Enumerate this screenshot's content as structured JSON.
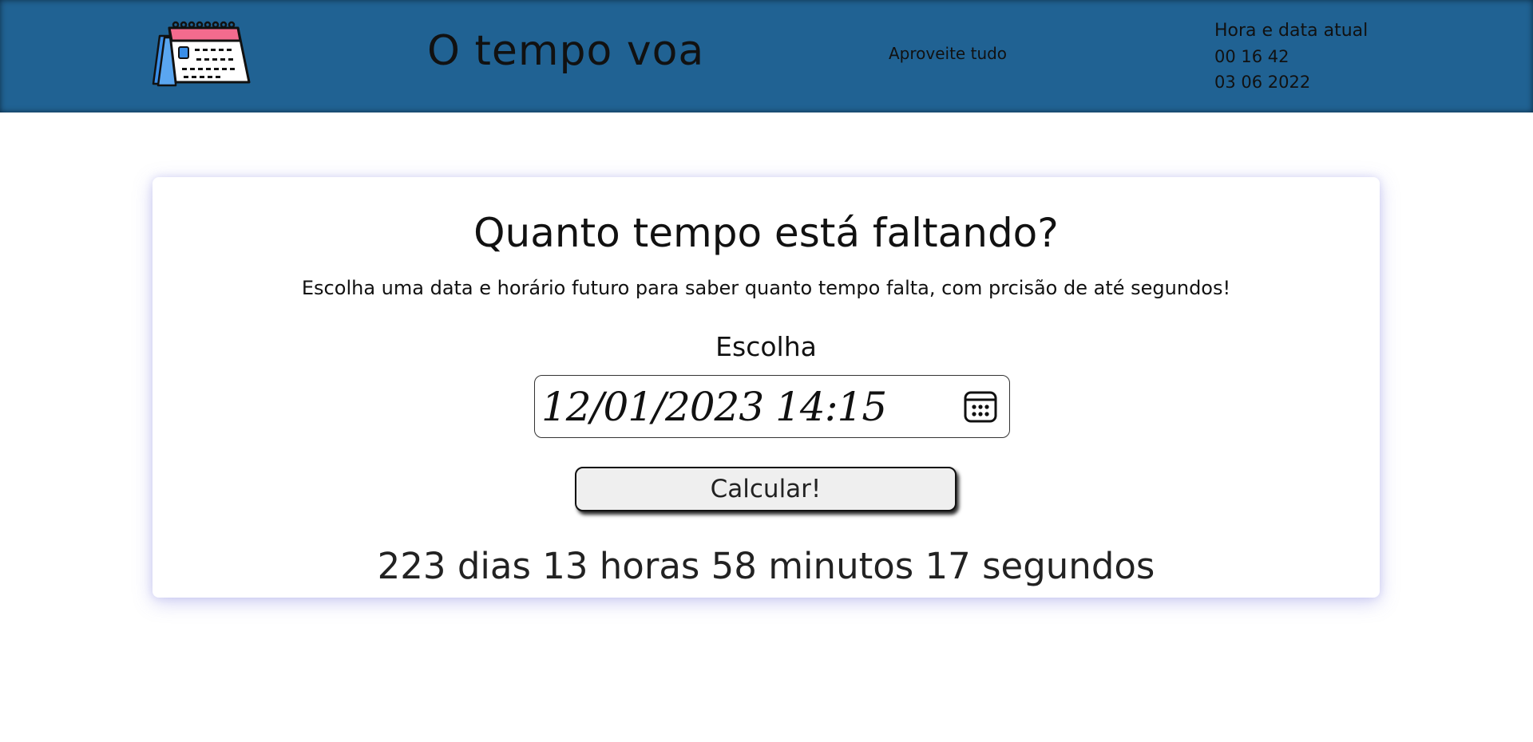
{
  "header": {
    "title": "O tempo voa",
    "tagline": "Aproveite tudo",
    "clock": {
      "label": "Hora e data atual",
      "time": "00 16 42",
      "date": "03 06 2022"
    },
    "background_color": "#206293"
  },
  "card": {
    "title": "Quanto tempo está faltando?",
    "subtitle": "Escolha uma data e horário futuro para saber quanto tempo falta, com prcisão de até segundos!",
    "field_label": "Escolha",
    "date_input_value": "12/01/2023 14:15",
    "button_label": "Calcular!",
    "result": "223 dias 13 horas 58 minutos 17 segundos"
  },
  "icons": {
    "logo": "calendar-icon",
    "picker": "calendar-picker-icon"
  },
  "colors": {
    "logo_pink": "#f36b8e",
    "logo_blue": "#3a8ee8",
    "shadow_glow": "#7878dc"
  }
}
